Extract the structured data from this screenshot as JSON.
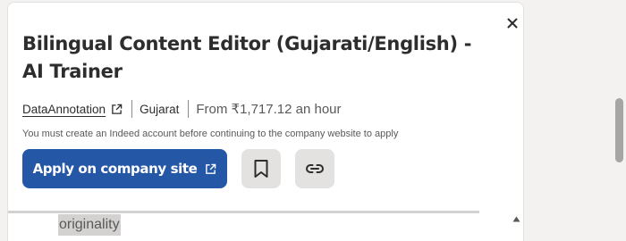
{
  "job": {
    "title": "Bilingual Content Editor (Gujarati/English) - AI Trainer",
    "company": "DataAnnotation",
    "location": "Gujarat",
    "salary": "From ₹1,717.12 an hour",
    "notice": "You must create an Indeed account before continuing to the company website to apply"
  },
  "actions": {
    "apply_label": "Apply on company site",
    "save_icon": "bookmark-icon",
    "copy_link_icon": "link-icon",
    "close_icon": "close-icon"
  },
  "description": {
    "highlighted_text": "originality"
  },
  "colors": {
    "apply_button": "#2557a7",
    "icon_button_bg": "#e4e2e0",
    "text": "#2d2d2d",
    "muted_text": "#595959"
  }
}
